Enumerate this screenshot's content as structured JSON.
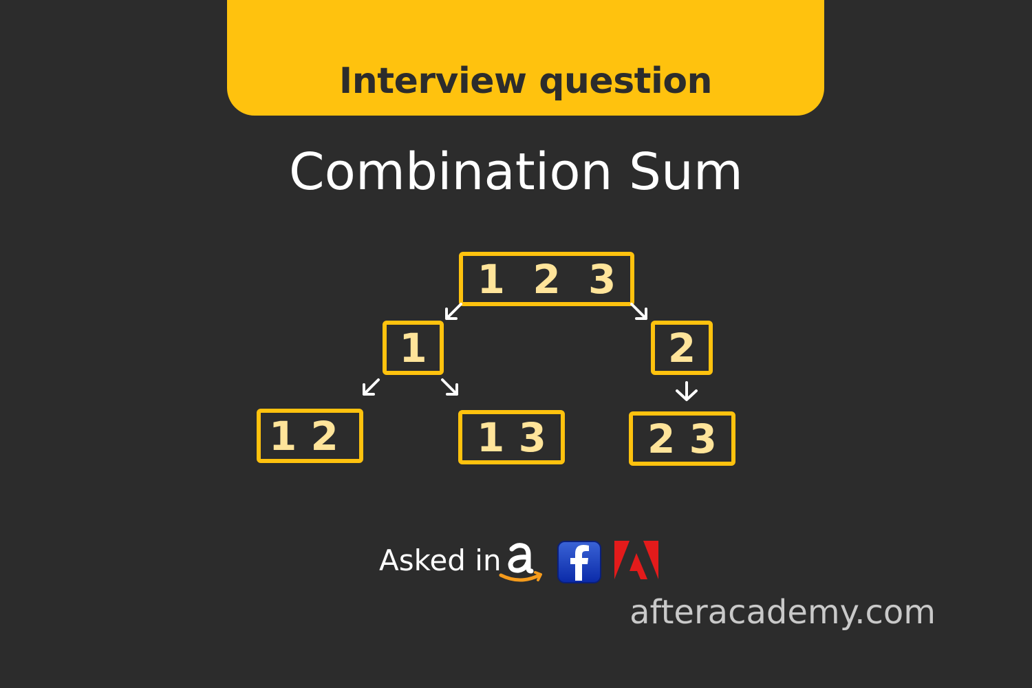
{
  "banner": {
    "label": "Interview question"
  },
  "title": "Combination Sum",
  "tree": {
    "root": "1  2  3",
    "left": "1",
    "right": "2",
    "left_left": "1 2",
    "left_right": "1 3",
    "right_child": "2 3"
  },
  "asked": {
    "label": "Asked in",
    "companies": [
      "amazon-logo",
      "facebook-logo",
      "adobe-logo"
    ]
  },
  "footer": {
    "site": "afteracademy.com"
  },
  "colors": {
    "background": "#2c2c2c",
    "accent": "#ffc20e",
    "node_text": "#ffe49a",
    "arrow": "#ffffff"
  }
}
